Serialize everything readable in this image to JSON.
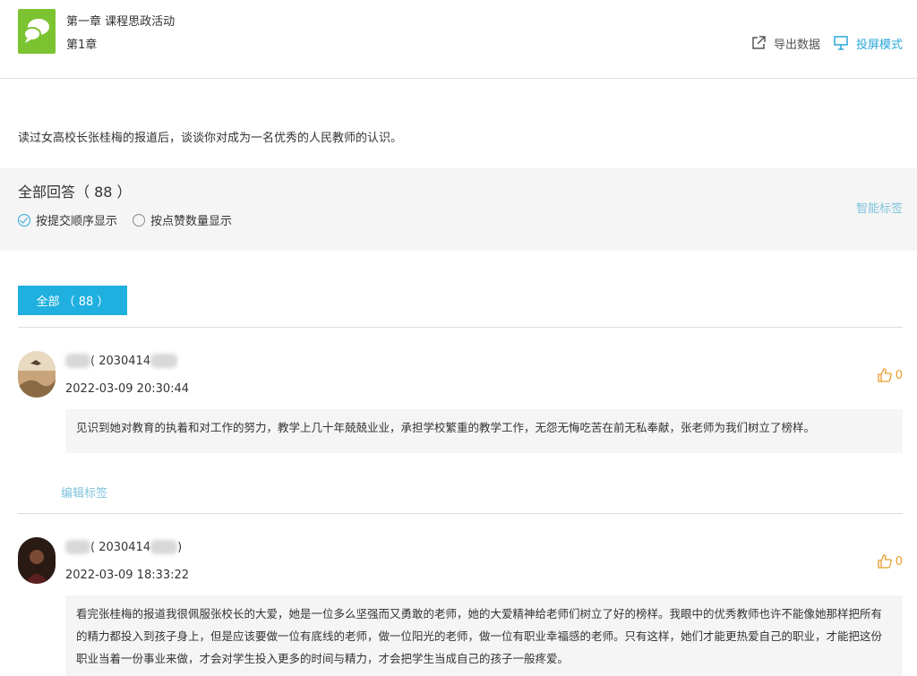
{
  "header": {
    "chapter_title": "第一章 课程思政活动",
    "chapter_sub": "第1章",
    "export_label": "导出数据",
    "screen_label": "投屏模式"
  },
  "question": "读过女高校长张桂梅的报道后，谈谈你对成为一名优秀的人民教师的认识。",
  "answers_panel": {
    "heading": "全部回答（ 88 ）",
    "sort_submit": "按提交顺序显示",
    "sort_likes": "按点赞数量显示",
    "smart_tag": "智能标签"
  },
  "filter_tab": "全部 （ 88 ）",
  "answers": [
    {
      "author_prefix": "( 2030414",
      "author_suffix": "",
      "timestamp": "2022-03-09 20:30:44",
      "likes": "0",
      "content": "见识到她对教育的执着和对工作的努力，教学上几十年兢兢业业，承担学校繁重的教学工作，无怨无悔吃苦在前无私奉献，张老师为我们树立了榜样。",
      "edit_tag": "编辑标签"
    },
    {
      "author_prefix": "( 2030414",
      "author_suffix": ")",
      "timestamp": "2022-03-09 18:33:22",
      "likes": "0",
      "content": "看完张桂梅的报道我很佩服张校长的大爱，她是一位多么坚强而又勇敢的老师，她的大爱精神给老师们树立了好的榜样。我眼中的优秀教师也许不能像她那样把所有的精力都投入到孩子身上，但是应该要做一位有底线的老师，做一位阳光的老师，做一位有职业幸福感的老师。只有这样，她们才能更热爱自己的职业，才能把这份职业当着一份事业来做，才会对学生投入更多的时间与精力，才会把学生当成自己的孩子一般疼爱。"
    }
  ],
  "colors": {
    "accent": "#1fb0e0",
    "logo_green": "#7cc332",
    "like_orange": "#e89c2c",
    "panel_bg": "#f5f5f5"
  }
}
